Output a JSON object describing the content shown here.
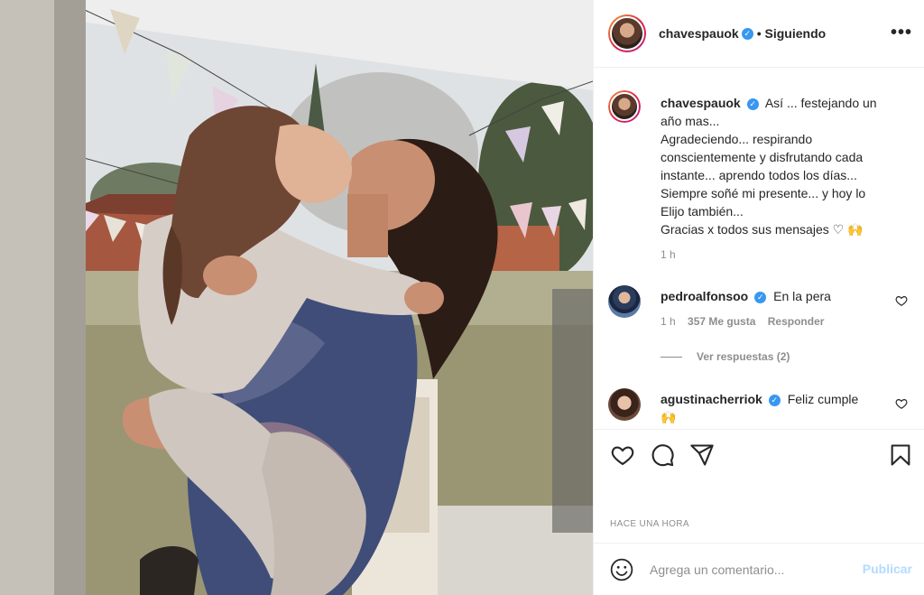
{
  "post": {
    "author": "chavespauok",
    "follow_status": "• Siguiendo",
    "more_icon": "more-horizontal-icon",
    "verified_icon": "verified-badge-icon"
  },
  "caption": {
    "username": "chavespauok",
    "lines": [
      "Así ... festejando un",
      "año mas...",
      "Agradeciendo... respirando",
      "conscientemente y disfrutando cada",
      "instante... aprendo todos los días...",
      "Siempre soñé mi presente... y hoy lo",
      "Elijo también...",
      "Gracias x todos sus mensajes ♡ 🙌"
    ],
    "time": "1 h"
  },
  "comments": [
    {
      "username": "pedroalfonsoo",
      "text": "En la pera",
      "time": "1 h",
      "likes": "357 Me gusta",
      "reply": "Responder",
      "view_replies": "Ver respuestas (2)"
    },
    {
      "username": "agustinacherriok",
      "text": "Feliz cumple",
      "text2": "🙌"
    }
  ],
  "actions": {
    "like_icon": "heart-icon",
    "comment_icon": "comment-icon",
    "share_icon": "share-icon",
    "save_icon": "bookmark-icon"
  },
  "timestamp": "HACE UNA HORA",
  "add_comment": {
    "placeholder": "Agrega un comentario...",
    "publish": "Publicar",
    "emoji_icon": "emoji-smile-icon"
  },
  "colors": {
    "verified": "#3897f0",
    "text": "#262626",
    "muted": "#8e8e8e",
    "publish_disabled": "#b3dbff",
    "border": "#efefef"
  }
}
